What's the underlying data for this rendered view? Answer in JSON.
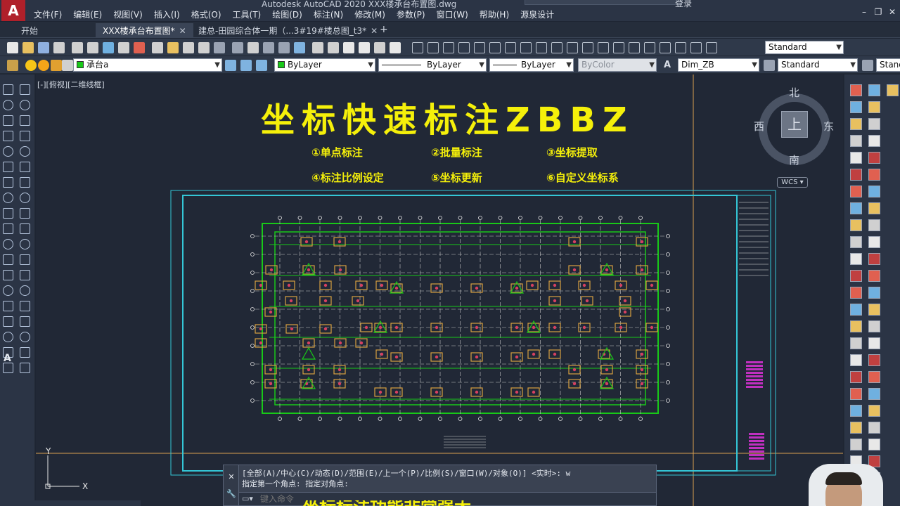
{
  "window": {
    "title": "Autodesk AutoCAD 2020   XXX楼承台布置图.dwg",
    "login": "登录"
  },
  "menu": [
    "文件(F)",
    "编辑(E)",
    "视图(V)",
    "插入(I)",
    "格式(O)",
    "工具(T)",
    "绘图(D)",
    "标注(N)",
    "修改(M)",
    "参数(P)",
    "窗口(W)",
    "帮助(H)",
    "源泉设计"
  ],
  "tabs": [
    {
      "label": "开始",
      "closable": false
    },
    {
      "label": "XXX楼承台布置图*",
      "closable": true,
      "active": true
    },
    {
      "label": "建总-田园综合体一期（...3#19#楼总图_t3*",
      "closable": true
    }
  ],
  "toolbar1": {
    "text_style": "Standard"
  },
  "toolbar2": {
    "layer": "承台a",
    "color": "ByLayer",
    "linetype": "ByLayer",
    "lineweight": "ByLayer",
    "plot_style": "ByColor",
    "dim_style": "Dim_ZB",
    "table_style": "Standard",
    "multileader_style": "Standard",
    "layer_color": "#18c818"
  },
  "viewport": {
    "label": "[-][俯视][二维线框]"
  },
  "overlay": {
    "title": "坐标快速标注ZBBZ",
    "features": [
      "①单点标注",
      "②批量标注",
      "③坐标提取",
      "④标注比例设定",
      "⑤坐标更新",
      "⑥自定义坐标系"
    ],
    "subtitle": "坐标标注功能非常强大",
    "accent": "#f5f00a"
  },
  "compass": {
    "north": "北",
    "south": "南",
    "east": "东",
    "west": "西",
    "top": "上",
    "wcs": "WCS"
  },
  "ucs": {
    "x": "X",
    "y": "Y"
  },
  "command": {
    "history": [
      "[全部(A)/中心(C)/动态(D)/范围(E)/上一个(P)/比例(S)/窗口(W)/对象(O)] <实时>: w",
      "指定第一个角点: 指定对角点:"
    ],
    "placeholder": "键入命令"
  }
}
